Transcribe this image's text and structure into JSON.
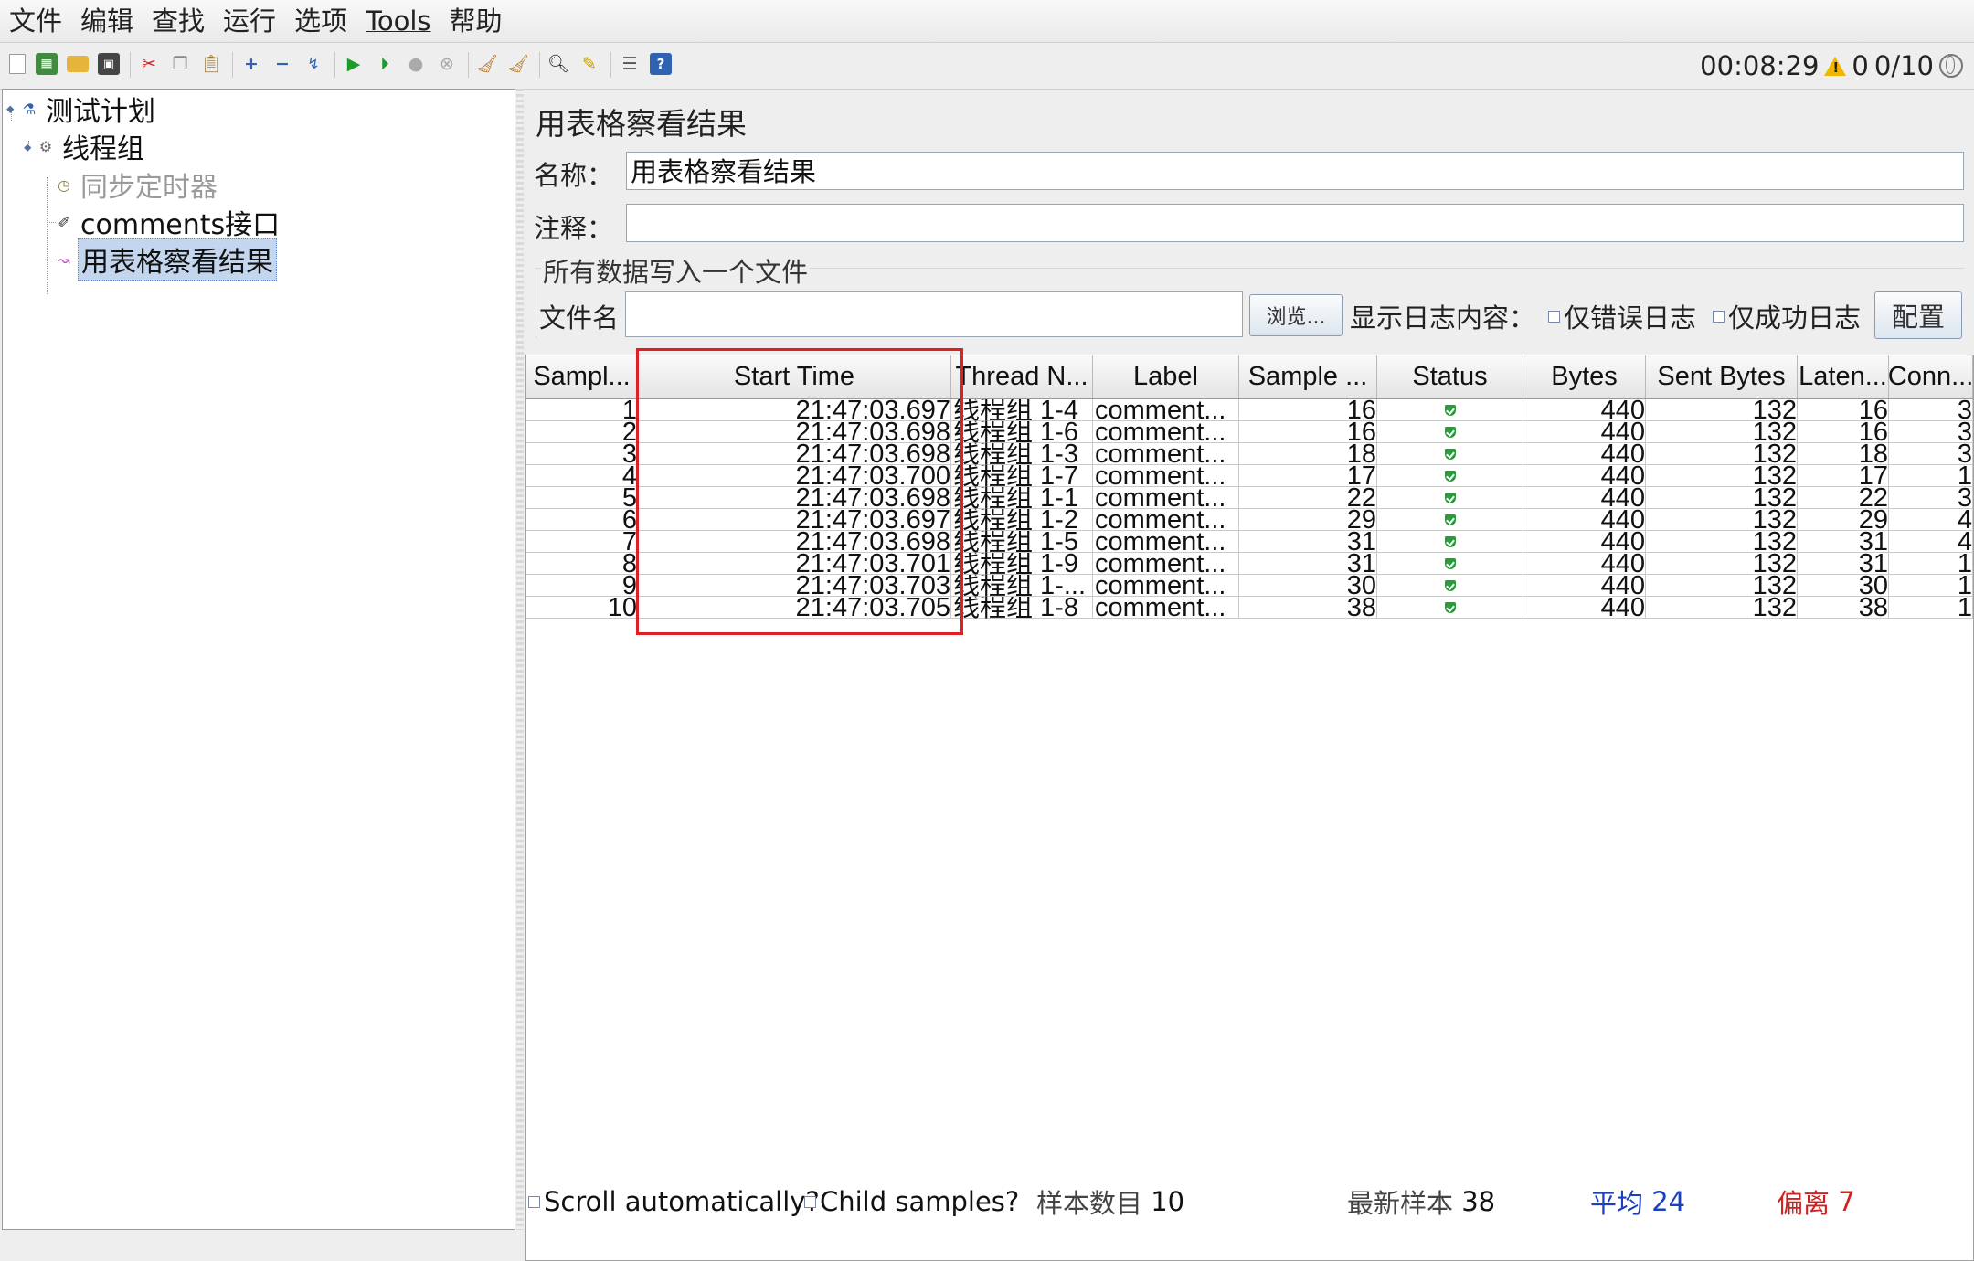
{
  "menu": [
    "文件",
    "编辑",
    "查找",
    "运行",
    "选项",
    "Tools",
    "帮助"
  ],
  "status": {
    "elapsed": "00:08:29",
    "warnings": "0",
    "threads": "0/10"
  },
  "tree": {
    "root": "测试计划",
    "thread_group": "线程组",
    "timer": "同步定时器",
    "sampler": "comments接口",
    "listener": "用表格察看结果"
  },
  "panel": {
    "title": "用表格察看结果",
    "name_label": "名称：",
    "name_value": "用表格察看结果",
    "comment_label": "注释：",
    "comment_value": "",
    "file_group_title": "所有数据写入一个文件",
    "file_label": "文件名",
    "file_value": "",
    "browse": "浏览...",
    "log_label": "显示日志内容：",
    "errors_only": "仅错误日志",
    "success_only": "仅成功日志",
    "configure": "配置"
  },
  "table": {
    "headers": [
      "Sampl...",
      "Start Time",
      "Thread N...",
      "Label",
      "Sample ...",
      "Status",
      "Bytes",
      "Sent Bytes",
      "Laten...",
      "Conn..."
    ],
    "rows": [
      [
        "1",
        "21:47:03.697",
        "线程组 1-4",
        "comment...",
        "16",
        "ok",
        "440",
        "132",
        "16",
        "3"
      ],
      [
        "2",
        "21:47:03.698",
        "线程组 1-6",
        "comment...",
        "16",
        "ok",
        "440",
        "132",
        "16",
        "3"
      ],
      [
        "3",
        "21:47:03.698",
        "线程组 1-3",
        "comment...",
        "18",
        "ok",
        "440",
        "132",
        "18",
        "3"
      ],
      [
        "4",
        "21:47:03.700",
        "线程组 1-7",
        "comment...",
        "17",
        "ok",
        "440",
        "132",
        "17",
        "1"
      ],
      [
        "5",
        "21:47:03.698",
        "线程组 1-1",
        "comment...",
        "22",
        "ok",
        "440",
        "132",
        "22",
        "3"
      ],
      [
        "6",
        "21:47:03.697",
        "线程组 1-2",
        "comment...",
        "29",
        "ok",
        "440",
        "132",
        "29",
        "4"
      ],
      [
        "7",
        "21:47:03.698",
        "线程组 1-5",
        "comment...",
        "31",
        "ok",
        "440",
        "132",
        "31",
        "4"
      ],
      [
        "8",
        "21:47:03.701",
        "线程组 1-9",
        "comment...",
        "31",
        "ok",
        "440",
        "132",
        "31",
        "1"
      ],
      [
        "9",
        "21:47:03.703",
        "线程组 1-...",
        "comment...",
        "30",
        "ok",
        "440",
        "132",
        "30",
        "1"
      ],
      [
        "10",
        "21:47:03.705",
        "线程组 1-8",
        "comment...",
        "38",
        "ok",
        "440",
        "132",
        "38",
        "1"
      ]
    ]
  },
  "bottom": {
    "scroll": "Scroll automatically?",
    "child": "Child samples?",
    "count_label": "样本数目",
    "count_value": "10",
    "latest_label": "最新样本",
    "latest_value": "38",
    "avg_label": "平均",
    "avg_value": "24",
    "dev_label": "偏离",
    "dev_value": "7"
  },
  "colors": {
    "avg": "#1a3fbf",
    "dev": "#d02020",
    "highlight": "#e02020",
    "selection": "#c4d6ee"
  }
}
